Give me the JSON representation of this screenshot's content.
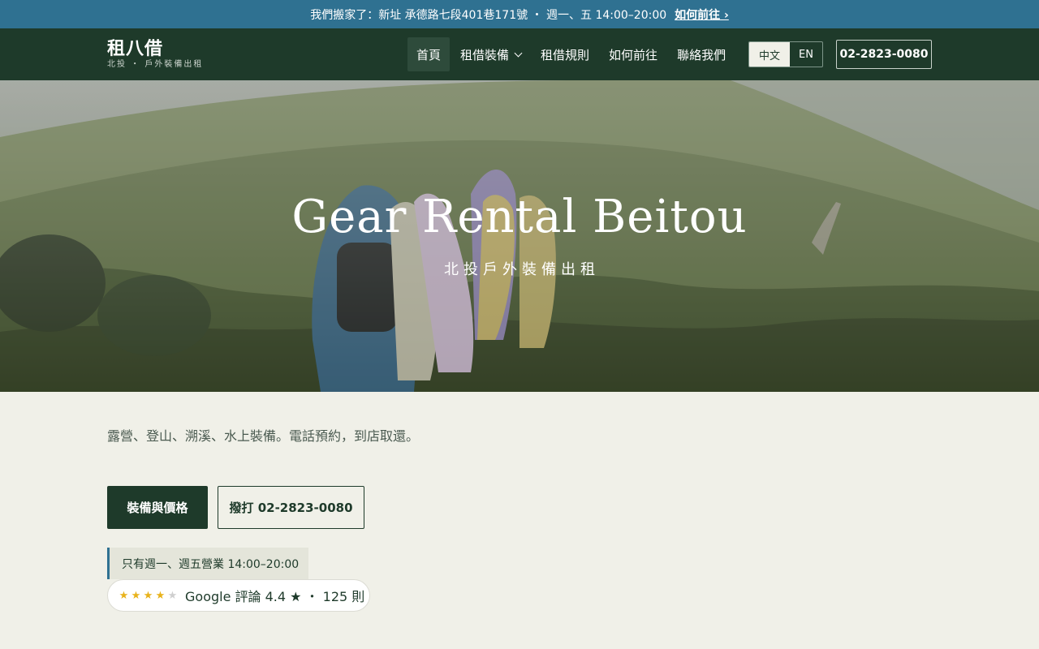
{
  "announcement": {
    "text": "我們搬家了：新址 承德路七段401巷171號 ・ 週一、五 14:00–20:00",
    "link": "如何前往 ›"
  },
  "brand": {
    "name": "租八借",
    "tagline": "北投 ・ 戶外裝備出租"
  },
  "nav": {
    "items": [
      {
        "label": "首頁",
        "active": true
      },
      {
        "label": "租借裝備",
        "dropdown": true
      },
      {
        "label": "租借規則"
      },
      {
        "label": "如何前往"
      },
      {
        "label": "聯絡我們"
      }
    ],
    "languages": [
      "中文",
      "EN"
    ],
    "active_language": "中文",
    "phone": "02-2823-0080"
  },
  "hero": {
    "title": "Gear Rental Beitou",
    "subtitle": "北投戶外裝備出租"
  },
  "main": {
    "intro": "露營、登山、溯溪、水上裝備。電話預約，到店取還。",
    "primary_cta": "裝備與價格",
    "secondary_cta": "撥打 02-2823-0080",
    "hours_note": "只有週一、週五營業 14:00–20:00",
    "review": {
      "rating": 4.4,
      "text": "Google 評論 4.4 ★ ・ 125 則",
      "stars_filled": 4,
      "stars_total": 5
    }
  },
  "colors": {
    "announcement_bg": "#2f7191",
    "nav_bg": "#1e3a2a",
    "page_bg": "#f0f0e8",
    "star": "#e8b21a"
  }
}
